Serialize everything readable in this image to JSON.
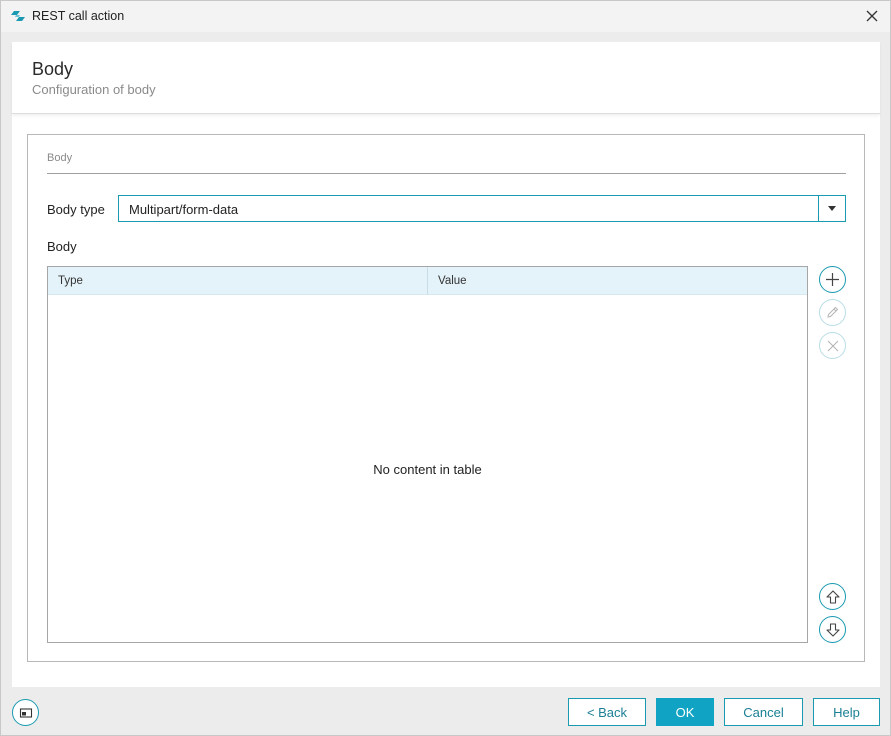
{
  "window": {
    "title": "REST call action"
  },
  "header": {
    "title": "Body",
    "subtitle": "Configuration of body"
  },
  "group": {
    "legend": "Body",
    "body_type_label": "Body type",
    "body_type_value": "Multipart/form-data",
    "body_label": "Body"
  },
  "table": {
    "columns": [
      "Type",
      "Value"
    ],
    "rows": [],
    "empty_message": "No content in table"
  },
  "side_buttons": [
    {
      "name": "add-icon",
      "enabled": true
    },
    {
      "name": "edit-icon",
      "enabled": false
    },
    {
      "name": "delete-icon",
      "enabled": false
    },
    {
      "name": "move-up-icon",
      "enabled": true
    },
    {
      "name": "move-down-icon",
      "enabled": true
    }
  ],
  "footer": {
    "back_label": "< Back",
    "ok_label": "OK",
    "cancel_label": "Cancel",
    "help_label": "Help"
  },
  "colors": {
    "accent": "#1a9ab0",
    "primary": "#11a3c3",
    "table_header": "#e4f3fa"
  }
}
